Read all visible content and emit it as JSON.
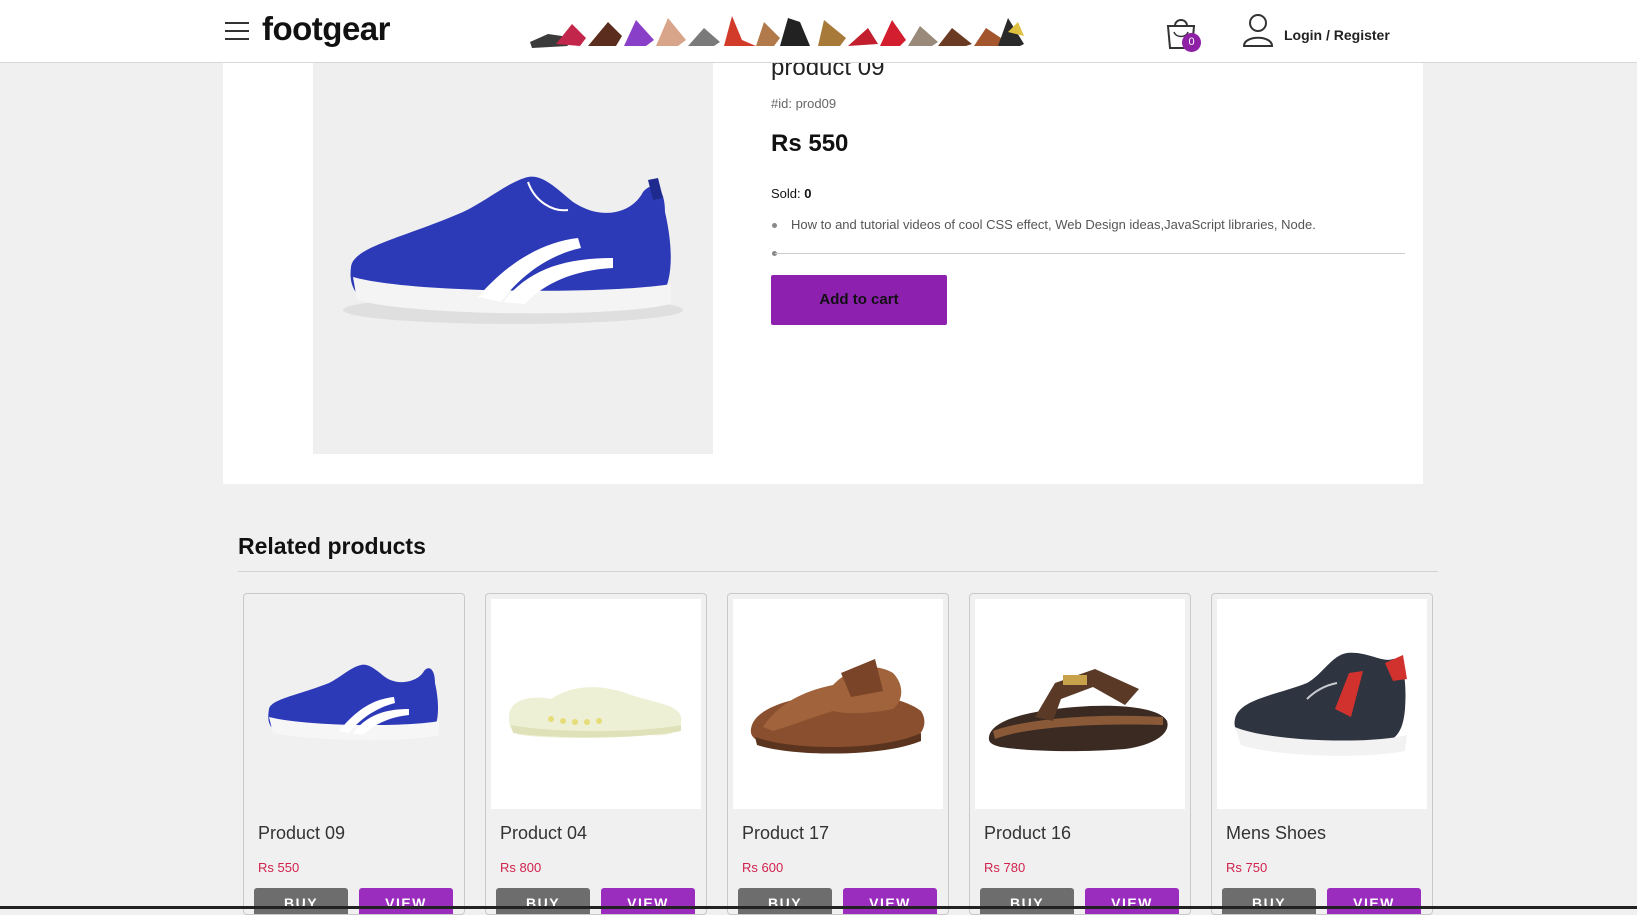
{
  "header": {
    "logo": "footgear",
    "cart_count": "0",
    "login_label": "Login / Register"
  },
  "product": {
    "title": "product 09",
    "id_label": "#id: prod09",
    "price": "Rs 550",
    "sold_label": "Sold:",
    "sold_value": "0",
    "description": "How to and tutorial videos of cool CSS effect, Web Design ideas,JavaScript libraries, Node.",
    "add_to_cart": "Add to cart"
  },
  "related": {
    "title": "Related products",
    "buy_label": "BUY",
    "view_label": "VIEW",
    "items": [
      {
        "name": "Product 09",
        "price": "Rs 550",
        "image": "blue-sneaker"
      },
      {
        "name": "Product 04",
        "price": "Rs 800",
        "image": "white-clog"
      },
      {
        "name": "Product 17",
        "price": "Rs 600",
        "image": "brown-sandal"
      },
      {
        "name": "Product 16",
        "price": "Rs 780",
        "image": "brown-flipflop"
      },
      {
        "name": "Mens Shoes",
        "price": "Rs 750",
        "image": "navy-sneaker"
      }
    ]
  },
  "colors": {
    "accent": "#8e20b0",
    "price_red": "#d0224c",
    "buy_gray": "#6d6d6d"
  }
}
